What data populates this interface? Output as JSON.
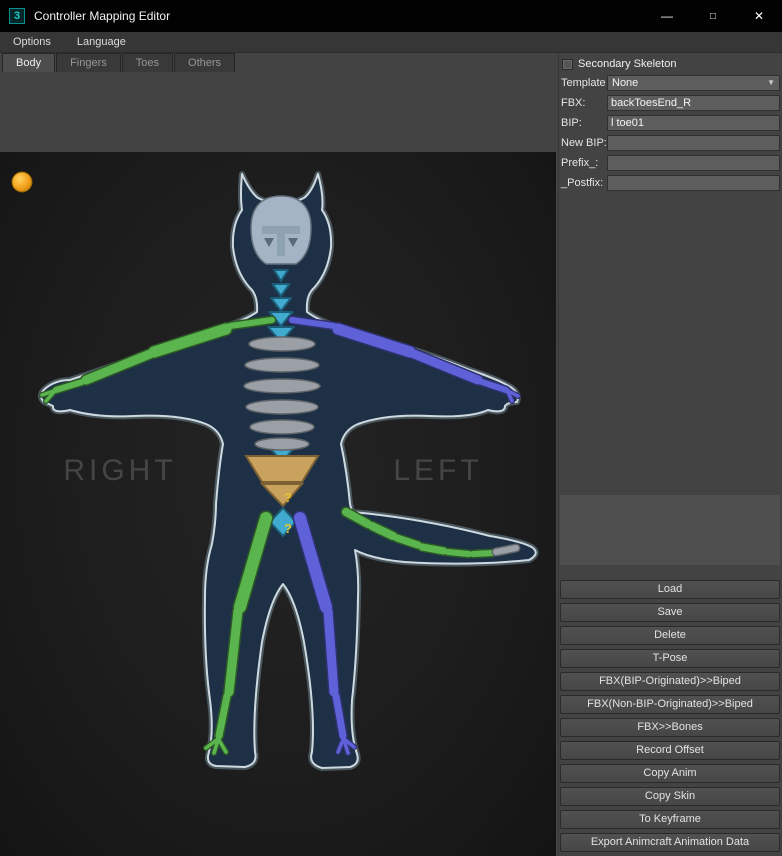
{
  "window": {
    "title": "Controller Mapping Editor",
    "app_icon_glyph": "3",
    "minimize_glyph": "—",
    "maximize_glyph": "□",
    "close_glyph": "✕"
  },
  "menu": {
    "items": [
      "Options",
      "Language"
    ]
  },
  "tabs": {
    "items": [
      "Body",
      "Fingers",
      "Toes",
      "Others"
    ],
    "active": "Body"
  },
  "viewport": {
    "right_marker": "RIGHT",
    "left_marker": "LEFT",
    "question_marks": [
      "?",
      "?"
    ]
  },
  "panel": {
    "secondary_skeleton_label": "Secondary Skeleton",
    "secondary_skeleton_checked": false,
    "template_label": "Template",
    "template_value": "None",
    "fields": [
      {
        "label": "FBX:",
        "value": "backToesEnd_R"
      },
      {
        "label": "BIP:",
        "value": "l toe01"
      },
      {
        "label": "New BIP:",
        "value": ""
      },
      {
        "label": "Prefix_:",
        "value": ""
      },
      {
        "label": "_Postfix:",
        "value": ""
      }
    ],
    "buttons": [
      "Load",
      "Save",
      "Delete",
      "T-Pose",
      "FBX(BIP-Originated)>>Biped",
      "FBX(Non-BIP-Originated)>>Biped",
      "FBX>>Bones",
      "Record Offset",
      "Copy Anim",
      "Copy Skin",
      "To Keyframe",
      "Export Animcraft Animation Data"
    ]
  },
  "colors": {
    "character_right_bones": "#5bb54e",
    "character_left_bones": "#5e61d8",
    "spine_bones": "#41aacf",
    "rib_bones": "#9aa0a6",
    "pelvis_bone": "#c9a25e",
    "indicator_dot": "#f2a11c",
    "silhouette_fill": "#1d3046",
    "silhouette_outline": "#cfd9e0"
  }
}
